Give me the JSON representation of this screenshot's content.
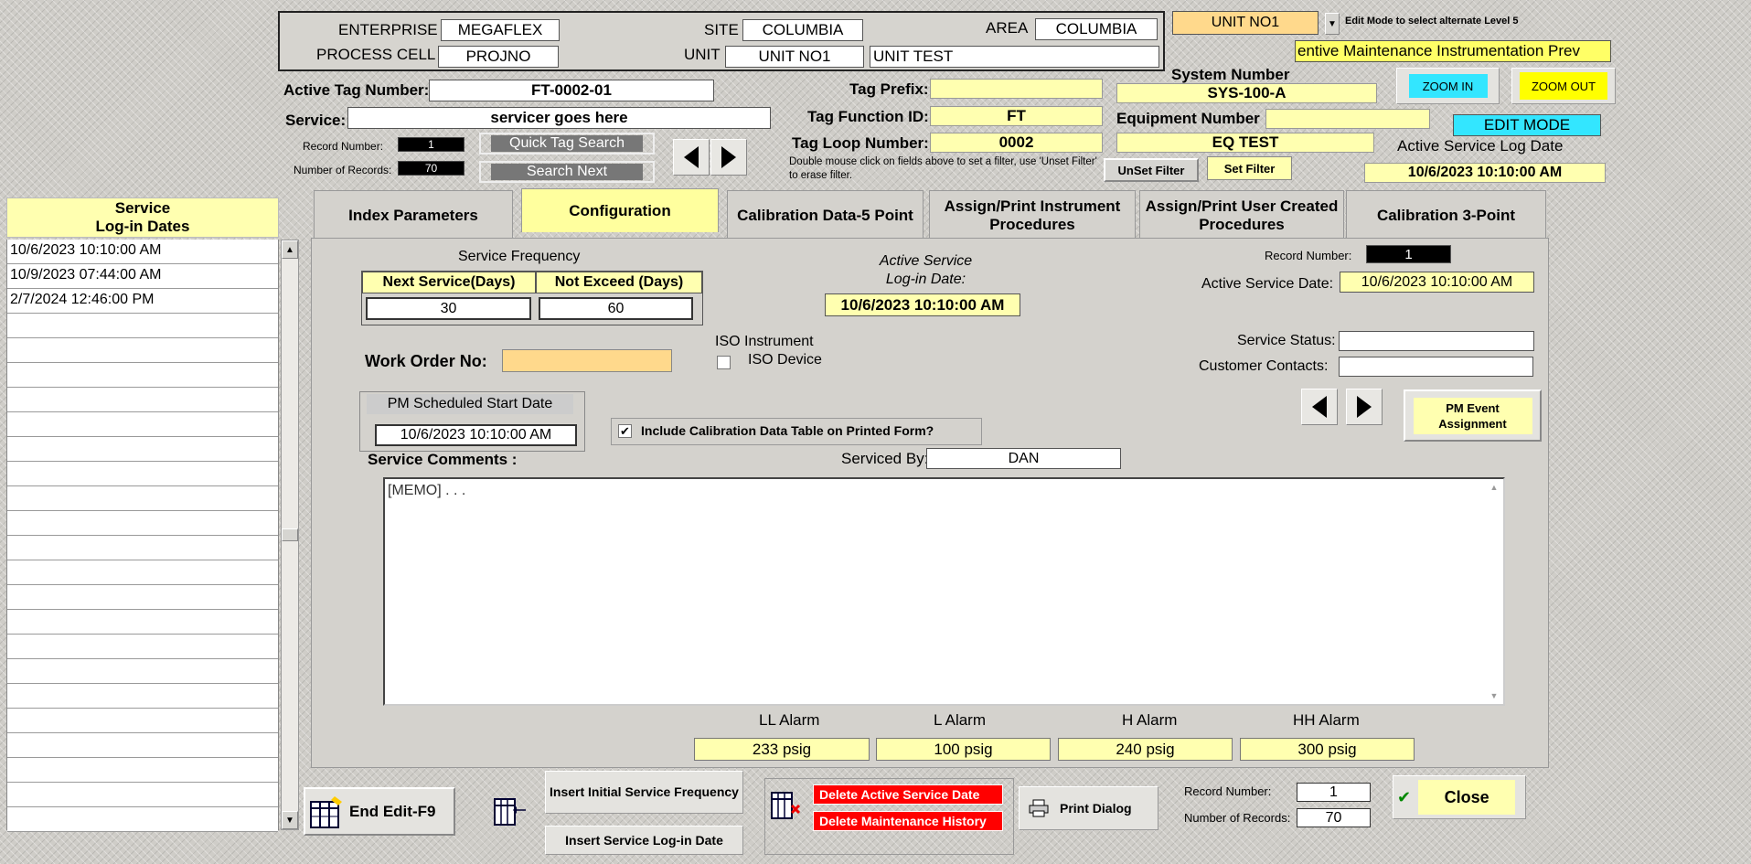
{
  "header": {
    "enterprise_label": "ENTERPRISE",
    "enterprise": "MEGAFLEX",
    "site_label": "SITE",
    "site": "COLUMBIA",
    "area_label": "AREA",
    "area": "COLUMBIA",
    "process_cell_label": "PROCESS CELL",
    "process_cell": "PROJNO",
    "unit_label": "UNIT",
    "unit": "UNIT NO1",
    "unit_desc": "UNIT TEST",
    "unit_select": "UNIT NO1",
    "edit_mode_hint": "Edit Mode to select alternate Level 5",
    "pm_banner": "entive Maintenance  Instrumentation Prev"
  },
  "tag": {
    "active_tag_label": "Active Tag Number:",
    "active_tag": "FT-0002-01",
    "service_label": "Service:",
    "service": "servicer goes here",
    "record_number_label": "Record Number:",
    "record_number": "1",
    "num_records_label": "Number of Records:",
    "num_records": "70",
    "quick_tag_search": "Quick Tag Search",
    "search_next": "Search Next",
    "tag_prefix_label": "Tag Prefix:",
    "tag_prefix": "",
    "tag_function_label": "Tag Function ID:",
    "tag_function": "FT",
    "tag_loop_label": "Tag Loop Number:",
    "tag_loop": "0002",
    "filter_hint": "Double mouse click on fields above to set a filter, use 'Unset Filter' to erase filter.",
    "unset_filter": "UnSet Filter",
    "set_filter": "Set Filter",
    "system_number_label": "System Number",
    "system_number": "SYS-100-A",
    "equipment_number_label": "Equipment Number",
    "equipment_number": "",
    "equipment_desc": "EQ TEST",
    "zoom_in": "ZOOM IN",
    "zoom_out": "ZOOM OUT",
    "edit_mode": "EDIT MODE",
    "active_log_date_label": "Active Service Log Date",
    "active_log_date": "10/6/2023 10:10:00 AM"
  },
  "sidebar": {
    "title_line1": "Service",
    "title_line2": "Log-in Dates",
    "dates": [
      "10/6/2023 10:10:00 AM",
      "10/9/2023 07:44:00 AM",
      "2/7/2024 12:46:00 PM"
    ]
  },
  "tabs": [
    {
      "label": "Index Parameters"
    },
    {
      "label": "Configuration"
    },
    {
      "label": "Calibration Data-5 Point"
    },
    {
      "label": "Assign/Print Instrument Procedures"
    },
    {
      "label": "Assign/Print User Created Procedures"
    },
    {
      "label": "Calibration 3-Point"
    }
  ],
  "config": {
    "service_frequency_label": "Service Frequency",
    "next_service_label": "Next Service(Days)",
    "next_service": "30",
    "not_exceed_label": "Not Exceed (Days)",
    "not_exceed": "60",
    "active_login_label1": "Active Service",
    "active_login_label2": "Log-in Date:",
    "active_login_date": "10/6/2023 10:10:00 AM",
    "record_number_label": "Record Number:",
    "record_number": "1",
    "active_service_date_label": "Active Service Date:",
    "active_service_date": "10/6/2023 10:10:00 AM",
    "work_order_label": "Work Order No:",
    "work_order": "",
    "iso_instrument_label": "ISO Instrument",
    "iso_device_label": "ISO Device",
    "service_status_label": "Service Status:",
    "service_status": "",
    "customer_contacts_label": "Customer Contacts:",
    "customer_contacts": "",
    "pm_start_label": "PM Scheduled Start Date",
    "pm_start": "10/6/2023 10:10:00 AM",
    "include_cal_label": "Include Calibration Data Table on Printed Form?",
    "pm_event_line1": "PM Event",
    "pm_event_line2": "Assignment",
    "comments_label": "Service Comments :",
    "serviced_by_label": "Serviced By:",
    "serviced_by": "DAN",
    "memo": "[MEMO] . . .",
    "alarms": [
      {
        "label": "LL Alarm",
        "value": "233 psig"
      },
      {
        "label": "L Alarm",
        "value": "100 psig"
      },
      {
        "label": "H Alarm",
        "value": "240 psig"
      },
      {
        "label": "HH Alarm",
        "value": "300 psig"
      }
    ]
  },
  "footer": {
    "end_edit": "End Edit-F9",
    "insert_initial_freq": "Insert Initial Service Frequency",
    "insert_login_date": "Insert Service Log-in Date",
    "delete_active_date": "Delete Active Service Date",
    "delete_history": "Delete Maintenance History",
    "print_dialog": "Print Dialog",
    "record_number_label": "Record Number:",
    "record_number": "1",
    "num_records_label": "Number of Records:",
    "num_records": "70",
    "close": "Close"
  },
  "colors": {
    "yellow_field": "#ffffb0",
    "peach_field": "#ffd98c",
    "zoom_in": "#33e6ff",
    "zoom_out": "#ffff00",
    "delete": "#ff0000"
  }
}
